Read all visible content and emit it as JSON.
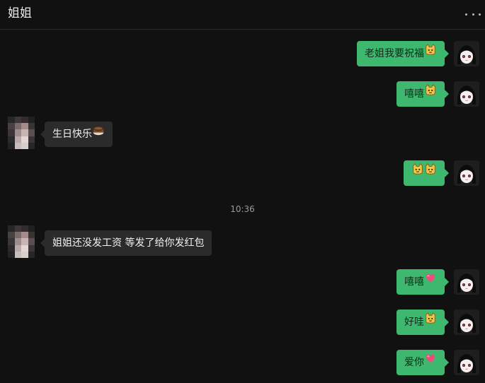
{
  "header": {
    "title": "姐姐",
    "more_icon": "more-dots-icon"
  },
  "messages": [
    {
      "from": "self",
      "text": "老姐我要祝福",
      "emoji": "cat-face-icon"
    },
    {
      "from": "self",
      "text": "嘻嘻",
      "emoji": "cat-face-icon"
    },
    {
      "from": "peer",
      "text": "生日快乐",
      "emoji": "cake-icon"
    },
    {
      "from": "self",
      "text": "",
      "emoji": "cat-face-icon x2"
    },
    {
      "from": "peer",
      "text": "姐姐还没发工资 等发了给你发红包",
      "emoji": ""
    },
    {
      "from": "self",
      "text": "嘻嘻",
      "emoji": "heart-icon"
    },
    {
      "from": "self",
      "text": "好哇",
      "emoji": "cat-face-icon"
    },
    {
      "from": "self",
      "text": "爱你",
      "emoji": "heart-icon"
    }
  ],
  "timestamp": "10:36",
  "colors": {
    "self_bubble": "#3fb86f",
    "peer_bubble": "#2b2b2b",
    "background": "#111111"
  }
}
